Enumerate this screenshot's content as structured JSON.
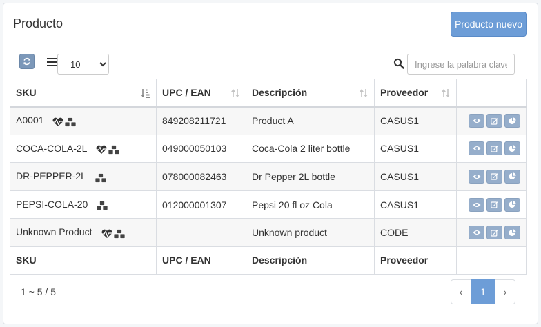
{
  "header": {
    "title": "Producto",
    "new_button": "Producto nuevo"
  },
  "toolbar": {
    "page_size": "10",
    "page_size_options": [
      "10"
    ],
    "search_placeholder": "Ingrese la palabra clave d"
  },
  "table": {
    "columns": [
      "SKU",
      "UPC / EAN",
      "Descripción",
      "Proveedor",
      ""
    ],
    "rows": [
      {
        "sku": "A0001",
        "upc": "849208211721",
        "desc": "Product A",
        "prov": "CASUS1",
        "icons": [
          "heartbeat-icon",
          "cubes-icon"
        ]
      },
      {
        "sku": "COCA-COLA-2L",
        "upc": "049000050103",
        "desc": "Coca-Cola 2 liter bottle",
        "prov": "CASUS1",
        "icons": [
          "heartbeat-icon",
          "cubes-icon"
        ]
      },
      {
        "sku": "DR-PEPPER-2L",
        "upc": "078000082463",
        "desc": "Dr Pepper 2L bottle",
        "prov": "CASUS1",
        "icons": [
          "cubes-icon"
        ]
      },
      {
        "sku": "PEPSI-COLA-20",
        "upc": "012000001307",
        "desc": "Pepsi 20 fl oz Cola",
        "prov": "CASUS1",
        "icons": [
          "cubes-icon"
        ]
      },
      {
        "sku": "Unknown Product",
        "upc": "",
        "desc": "Unknown product",
        "prov": "CODE",
        "icons": [
          "heartbeat-icon",
          "cubes-icon"
        ]
      }
    ]
  },
  "footer": {
    "summary": "1 ~ 5 / 5",
    "prev": "‹",
    "current_page": "1",
    "next": "›"
  },
  "colors": {
    "primary": "#6d9dd7",
    "action_button": "#96aecb",
    "refresh_button": "#7c98b9"
  }
}
